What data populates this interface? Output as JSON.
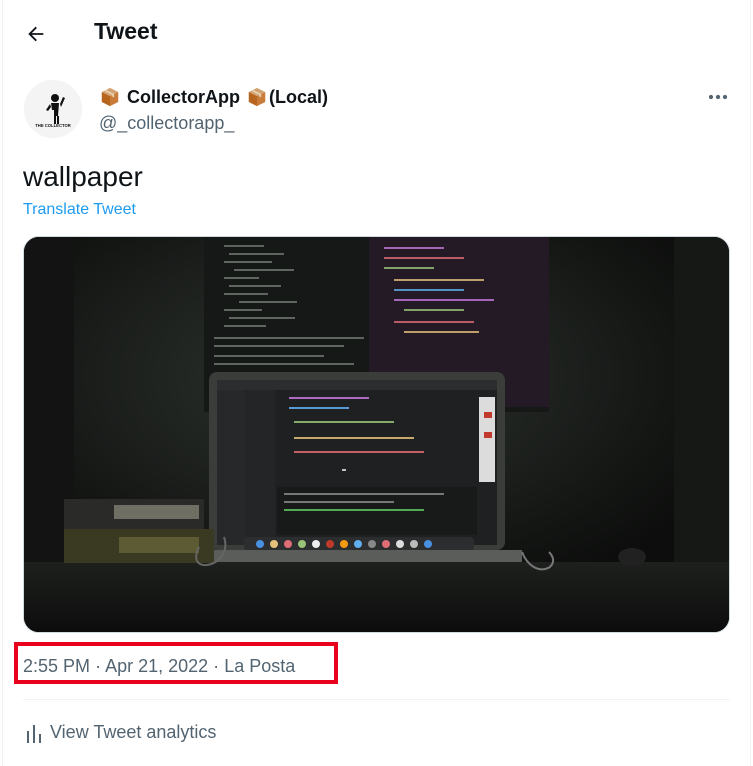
{
  "header": {
    "title": "Tweet"
  },
  "author": {
    "name": "CollectorApp",
    "name_suffix": "(Local)",
    "handle": "@_collectorapp_",
    "avatar_text": "THE COLLECTOR"
  },
  "tweet": {
    "text": "wallpaper",
    "translate_label": "Translate Tweet",
    "media_caption_spine": "THE PRAGMATIC",
    "time": "2:55 PM",
    "date": "Apr 21, 2022",
    "source": "La Posta",
    "separator": "·"
  },
  "analytics": {
    "label": "View Tweet analytics"
  },
  "colors": {
    "accent": "#1d9bf0",
    "highlight": "#e8001c",
    "secondary_text": "#536471"
  },
  "icons": [
    "back-arrow-icon",
    "package-icon",
    "more-icon",
    "analytics-bars-icon"
  ]
}
